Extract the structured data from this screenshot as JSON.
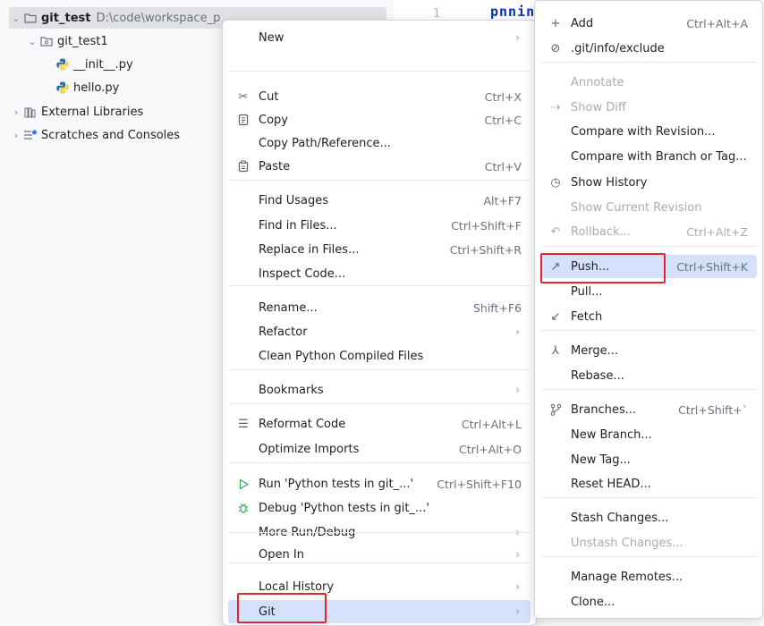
{
  "tree": {
    "root": {
      "name": "git_test",
      "path": "D:\\code\\workspace_p"
    },
    "folder": "git_test1",
    "files": [
      "__init__.py",
      "hello.py"
    ],
    "external": "External Libraries",
    "scratches": "Scratches and Consoles"
  },
  "editor": {
    "line_no": "1",
    "code": "pnnin"
  },
  "menu_main": [
    {
      "label": "New",
      "icon": "",
      "shortcut": "",
      "submenu": true
    },
    {
      "label": "Cut",
      "icon": "scissors-icon",
      "shortcut": "Ctrl+X"
    },
    {
      "label": "Copy",
      "icon": "copy-icon",
      "shortcut": "Ctrl+C"
    },
    {
      "label": "Copy Path/Reference...",
      "icon": "",
      "shortcut": ""
    },
    {
      "label": "Paste",
      "icon": "paste-icon",
      "shortcut": "Ctrl+V"
    },
    {
      "label": "Find Usages",
      "icon": "",
      "shortcut": "Alt+F7"
    },
    {
      "label": "Find in Files...",
      "icon": "",
      "shortcut": "Ctrl+Shift+F"
    },
    {
      "label": "Replace in Files...",
      "icon": "",
      "shortcut": "Ctrl+Shift+R"
    },
    {
      "label": "Inspect Code...",
      "icon": "",
      "shortcut": ""
    },
    {
      "label": "Rename...",
      "icon": "",
      "shortcut": "Shift+F6"
    },
    {
      "label": "Refactor",
      "icon": "",
      "shortcut": "",
      "submenu": true
    },
    {
      "label": "Clean Python Compiled Files",
      "icon": "",
      "shortcut": ""
    },
    {
      "label": "Bookmarks",
      "icon": "",
      "shortcut": "",
      "submenu": true
    },
    {
      "label": "Reformat Code",
      "icon": "reformat-icon",
      "shortcut": "Ctrl+Alt+L"
    },
    {
      "label": "Optimize Imports",
      "icon": "",
      "shortcut": "Ctrl+Alt+O"
    },
    {
      "label": "Run 'Python tests in git_...'",
      "icon": "run-icon",
      "shortcut": "Ctrl+Shift+F10"
    },
    {
      "label": "Debug 'Python tests in git_...'",
      "icon": "debug-icon",
      "shortcut": ""
    },
    {
      "label": "More Run/Debug",
      "icon": "",
      "shortcut": "",
      "submenu": true
    },
    {
      "label": "Open In",
      "icon": "",
      "shortcut": "",
      "submenu": true
    },
    {
      "label": "Local History",
      "icon": "",
      "shortcut": "",
      "submenu": true
    },
    {
      "label": "Git",
      "icon": "",
      "shortcut": "",
      "submenu": true,
      "highlighted": true
    }
  ],
  "menu_git": [
    {
      "label": "Add",
      "icon": "plus-icon",
      "shortcut": "Ctrl+Alt+A"
    },
    {
      "label": ".git/info/exclude",
      "icon": "ignore-icon",
      "shortcut": ""
    },
    {
      "label": "Annotate",
      "icon": "",
      "shortcut": "",
      "disabled": true
    },
    {
      "label": "Show Diff",
      "icon": "diff-icon",
      "shortcut": "",
      "disabled": true
    },
    {
      "label": "Compare with Revision...",
      "icon": "",
      "shortcut": ""
    },
    {
      "label": "Compare with Branch or Tag...",
      "icon": "",
      "shortcut": ""
    },
    {
      "label": "Show History",
      "icon": "history-icon",
      "shortcut": ""
    },
    {
      "label": "Show Current Revision",
      "icon": "",
      "shortcut": "",
      "disabled": true
    },
    {
      "label": "Rollback...",
      "icon": "rollback-icon",
      "shortcut": "Ctrl+Alt+Z",
      "disabled": true
    },
    {
      "label": "Push...",
      "icon": "push-icon",
      "shortcut": "Ctrl+Shift+K",
      "highlighted": true
    },
    {
      "label": "Pull...",
      "icon": "",
      "shortcut": ""
    },
    {
      "label": "Fetch",
      "icon": "fetch-icon",
      "shortcut": ""
    },
    {
      "label": "Merge...",
      "icon": "merge-icon",
      "shortcut": ""
    },
    {
      "label": "Rebase...",
      "icon": "",
      "shortcut": ""
    },
    {
      "label": "Branches...",
      "icon": "branch-icon",
      "shortcut": "Ctrl+Shift+`"
    },
    {
      "label": "New Branch...",
      "icon": "",
      "shortcut": ""
    },
    {
      "label": "New Tag...",
      "icon": "",
      "shortcut": ""
    },
    {
      "label": "Reset HEAD...",
      "icon": "",
      "shortcut": ""
    },
    {
      "label": "Stash Changes...",
      "icon": "",
      "shortcut": ""
    },
    {
      "label": "Unstash Changes...",
      "icon": "",
      "shortcut": "",
      "disabled": true
    },
    {
      "label": "Manage Remotes...",
      "icon": "",
      "shortcut": ""
    },
    {
      "label": "Clone...",
      "icon": "",
      "shortcut": ""
    }
  ],
  "colors": {
    "highlight": "#d5e1fb",
    "annotation_box": "#e0262a",
    "python_blue": "#3572a5",
    "python_yellow": "#ffd43b"
  }
}
